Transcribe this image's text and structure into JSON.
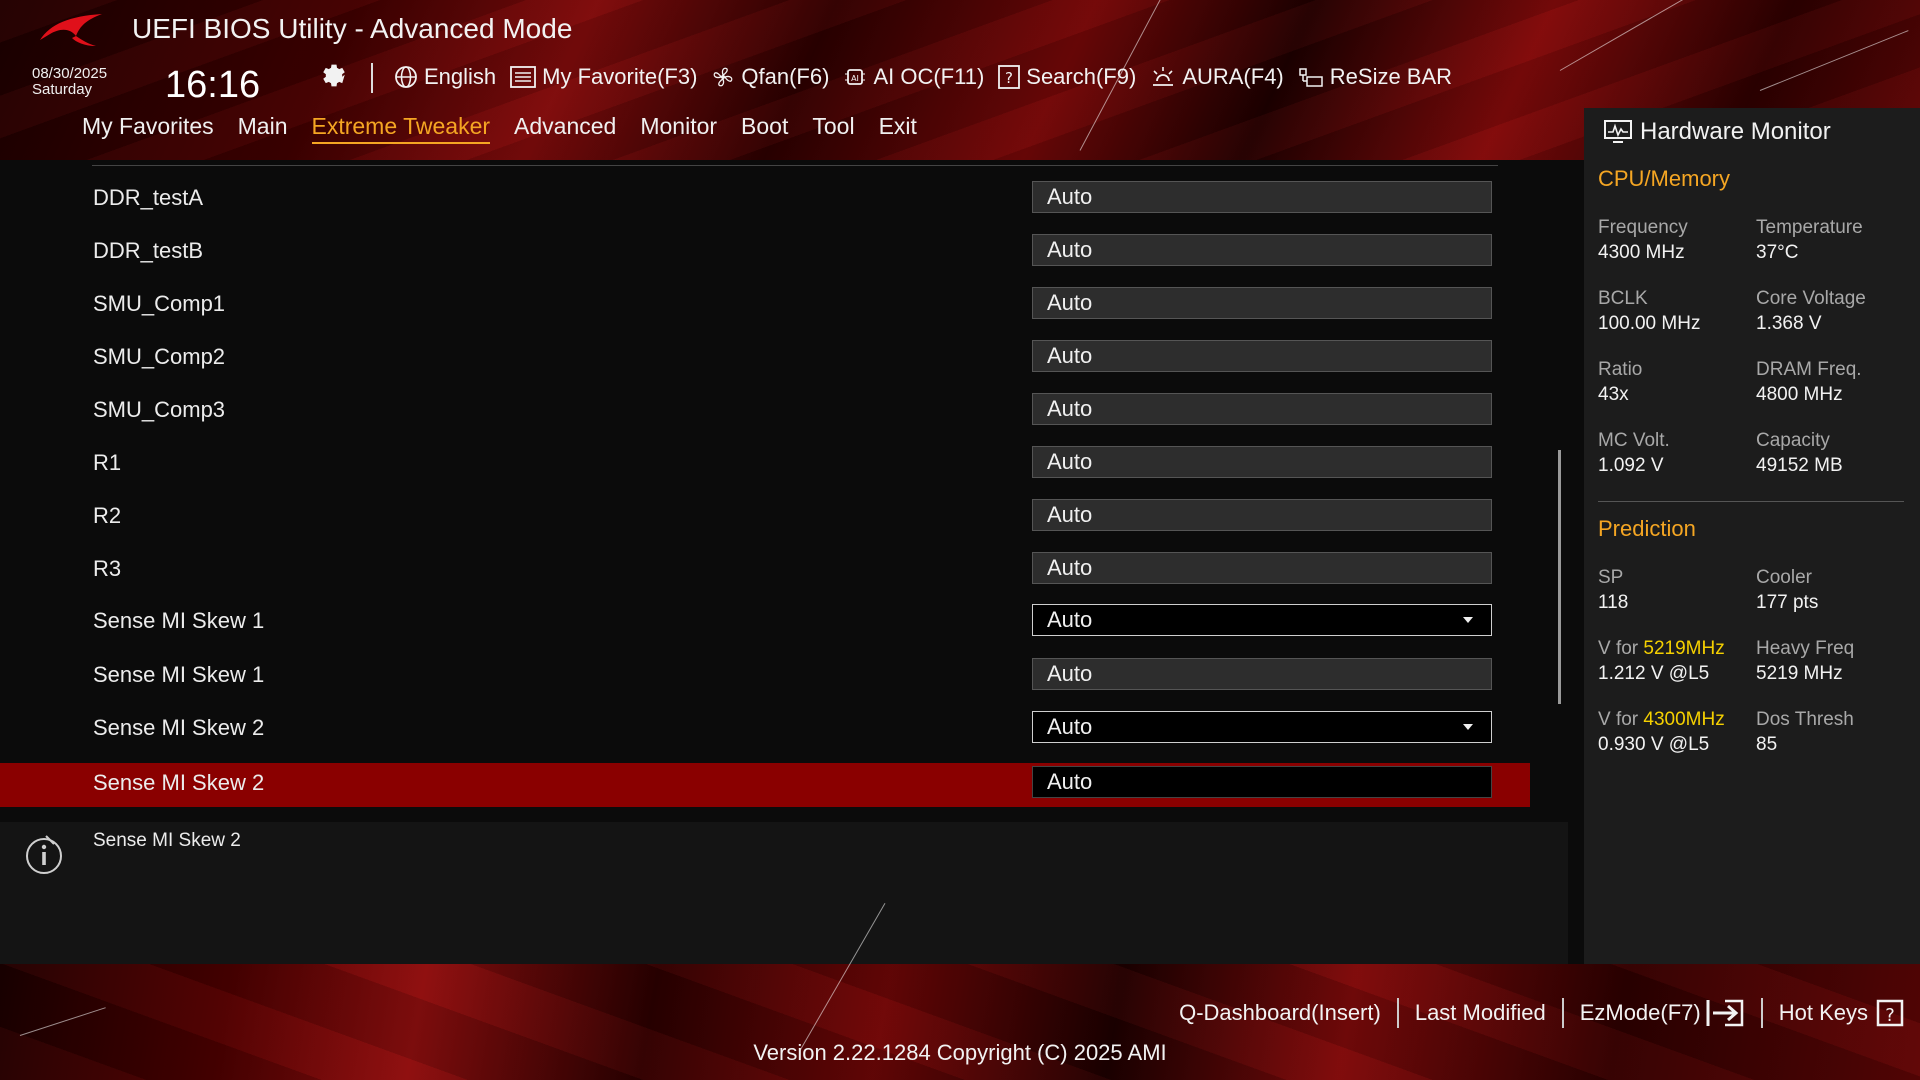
{
  "window": {
    "title": "UEFI BIOS Utility - Advanced Mode"
  },
  "status": {
    "date": "08/30/2025",
    "day": "Saturday",
    "time": "16:16"
  },
  "toolbar": {
    "language": "English",
    "my_favorite": "My Favorite(F3)",
    "qfan": "Qfan(F6)",
    "ai_oc": "AI OC(F11)",
    "search": "Search(F9)",
    "aura": "AURA(F4)",
    "resize_bar": "ReSize BAR"
  },
  "nav": {
    "items": [
      "My Favorites",
      "Main",
      "Extreme Tweaker",
      "Advanced",
      "Monitor",
      "Boot",
      "Tool",
      "Exit"
    ],
    "active": "Extreme Tweaker"
  },
  "settings": [
    {
      "label": "DDR_testA",
      "value": "Auto",
      "kind": "field"
    },
    {
      "label": "DDR_testB",
      "value": "Auto",
      "kind": "field"
    },
    {
      "label": "SMU_Comp1",
      "value": "Auto",
      "kind": "field"
    },
    {
      "label": "SMU_Comp2",
      "value": "Auto",
      "kind": "field"
    },
    {
      "label": "SMU_Comp3",
      "value": "Auto",
      "kind": "field"
    },
    {
      "label": "R1",
      "value": "Auto",
      "kind": "field"
    },
    {
      "label": "R2",
      "value": "Auto",
      "kind": "field"
    },
    {
      "label": "R3",
      "value": "Auto",
      "kind": "field"
    },
    {
      "label": "Sense MI Skew 1",
      "value": "Auto",
      "kind": "dropdown"
    },
    {
      "label": "Sense MI Skew 1",
      "value": "Auto",
      "kind": "field"
    },
    {
      "label": "Sense MI Skew 2",
      "value": "Auto",
      "kind": "dropdown"
    },
    {
      "label": "Sense MI Skew 2",
      "value": "Auto",
      "kind": "field",
      "selected": true
    }
  ],
  "help": {
    "text": "Sense MI Skew 2"
  },
  "hardware_monitor": {
    "title": "Hardware Monitor",
    "cpu_memory": {
      "heading": "CPU/Memory",
      "frequency_label": "Frequency",
      "frequency": "4300 MHz",
      "temperature_label": "Temperature",
      "temperature": "37°C",
      "bclk_label": "BCLK",
      "bclk": "100.00 MHz",
      "core_voltage_label": "Core Voltage",
      "core_voltage": "1.368 V",
      "ratio_label": "Ratio",
      "ratio": "43x",
      "dram_freq_label": "DRAM Freq.",
      "dram_freq": "4800 MHz",
      "mc_volt_label": "MC Volt.",
      "mc_volt": "1.092 V",
      "capacity_label": "Capacity",
      "capacity": "49152 MB"
    },
    "prediction": {
      "heading": "Prediction",
      "sp_label": "SP",
      "sp": "118",
      "cooler_label": "Cooler",
      "cooler": "177 pts",
      "v_for_prefix": "V for",
      "v_for_freq_1": "5219MHz",
      "v_for_1": "1.212 V @L5",
      "heavy_freq_label": "Heavy Freq",
      "heavy_freq": "5219 MHz",
      "v_for_freq_2": "4300MHz",
      "v_for_2": "0.930 V @L5",
      "dos_thresh_label": "Dos Thresh",
      "dos_thresh": "85"
    }
  },
  "footer": {
    "q_dashboard": "Q-Dashboard(Insert)",
    "last_modified": "Last Modified",
    "ezmode": "EzMode(F7)",
    "hot_keys": "Hot Keys",
    "version": "Version 2.22.1284 Copyright (C) 2025 AMI"
  },
  "colors": {
    "accent": "#f5a623",
    "selected_row": "#8a0000",
    "highlight": "#f5d000"
  }
}
